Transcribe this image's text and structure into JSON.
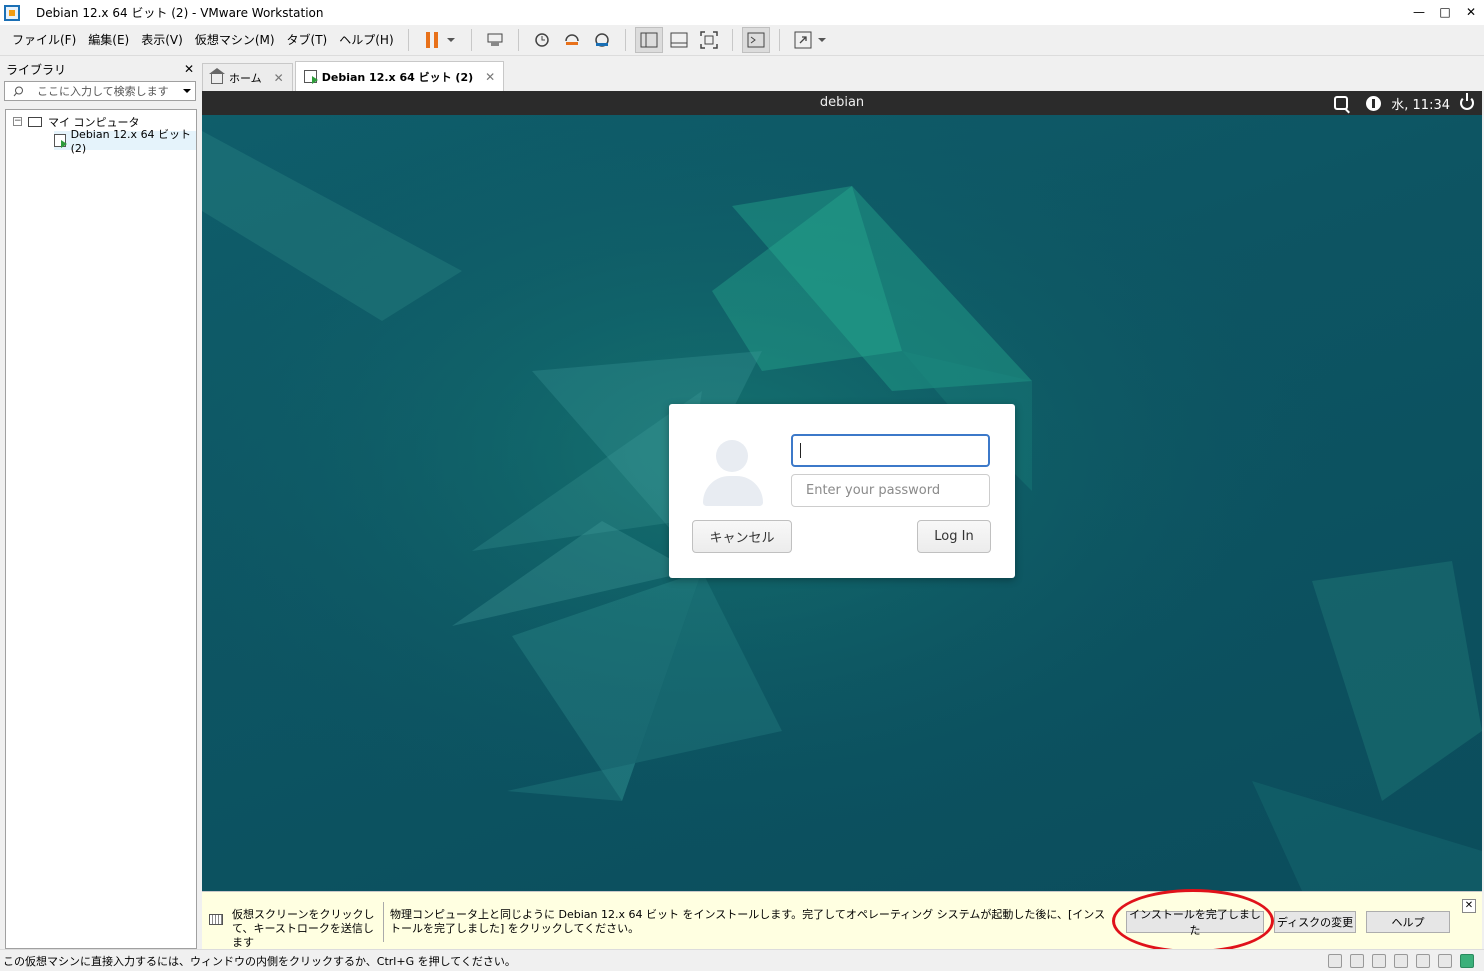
{
  "window": {
    "title": "Debian 12.x 64 ビット (2) - VMware Workstation",
    "minimize": "—",
    "maximize": "□",
    "close": "✕"
  },
  "menubar": {
    "items": [
      "ファイル(F)",
      "編集(E)",
      "表示(V)",
      "仮想マシン(M)",
      "タブ(T)",
      "ヘルプ(H)"
    ]
  },
  "toolbar": {
    "icons": [
      "pause-icon",
      "send-ctrl-alt-del-icon",
      "snapshot-take-icon",
      "snapshot-revert-icon",
      "snapshot-manager-icon",
      "view-library-icon",
      "view-thumbnail-icon",
      "view-fullscreen-icon",
      "console-icon",
      "stretch-icon"
    ]
  },
  "library": {
    "title": "ライブラリ",
    "close": "✕",
    "search_placeholder": "ここに入力して検索します",
    "tree": {
      "root": "マイ コンピュータ",
      "vm": "Debian 12.x 64 ビット (2)"
    }
  },
  "tabs": [
    {
      "label": "ホーム",
      "close": "✕",
      "icon": "home-icon"
    },
    {
      "label": "Debian 12.x 64 ビット (2)",
      "close": "✕",
      "icon": "vm-icon"
    }
  ],
  "guest": {
    "hostname": "debian",
    "clock": "水, 11:34",
    "login": {
      "username_value": "",
      "password_placeholder": "Enter your password",
      "cancel_label": "キャンセル",
      "login_label": "Log In"
    }
  },
  "infobar": {
    "hint": "仮想スクリーンをクリックして、キーストロークを送信します",
    "message": "物理コンピュータ上と同じように Debian 12.x 64 ビット をインストールします。完了してオペレーティング システムが起動した後に、[インストールを完了しました] をクリックしてください。",
    "finish_button": "インストールを完了しました",
    "change_disk_button": "ディスクの変更",
    "help_button": "ヘルプ",
    "close": "✕"
  },
  "statusbar": {
    "message": "この仮想マシンに直接入力するには、ウィンドウの内側をクリックするか、Ctrl+G を押してください。"
  },
  "colors": {
    "desktop": "#0d5563",
    "accent_focus": "#3c79c9",
    "pause_orange": "#e8711a",
    "annotation_red": "#e0121a",
    "infobar_bg": "#ffffe1"
  }
}
